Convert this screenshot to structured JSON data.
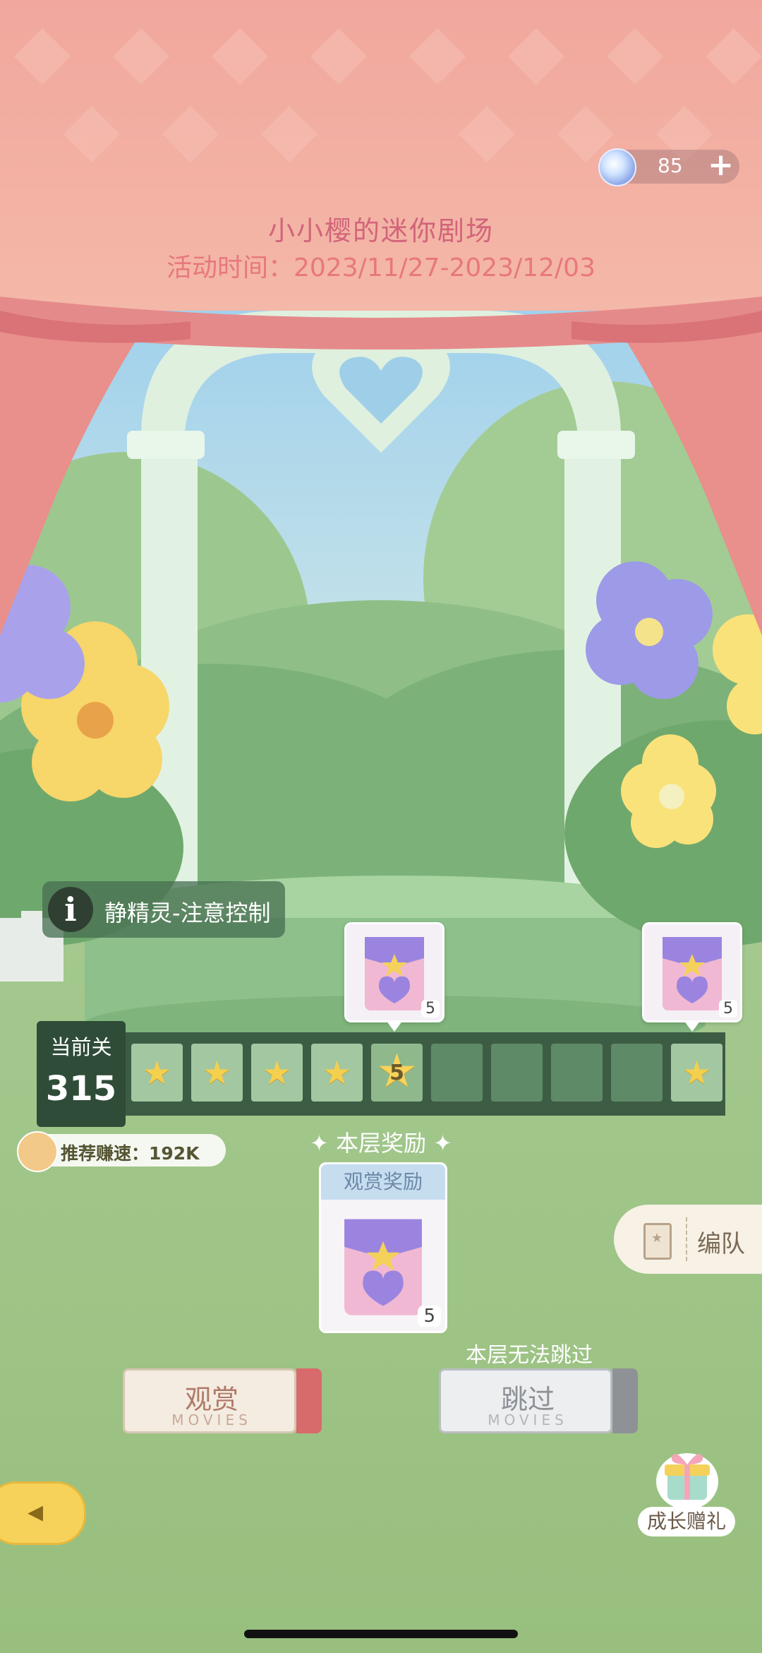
{
  "currency": {
    "value": "85",
    "plus": "+",
    "icon": "crystal-gem-icon"
  },
  "event": {
    "title": "小小樱的迷你剧场",
    "time": "活动时间：2023/11/27-2023/12/03"
  },
  "hint": {
    "icon": "info-icon",
    "label": "静精灵-注意控制"
  },
  "level": {
    "label": "当前关",
    "number": "315"
  },
  "track": {
    "current_label": "5",
    "cells": [
      "star",
      "star",
      "star",
      "star",
      "current",
      "empty",
      "empty",
      "empty",
      "empty",
      "star"
    ]
  },
  "milestone_rewards": [
    {
      "count": "5",
      "icon": "gift-bag-icon"
    },
    {
      "count": "5",
      "icon": "gift-bag-icon"
    }
  ],
  "recommend": {
    "label": "推荐赚速：192K"
  },
  "floor_reward": {
    "title": "✦ 本层奖励 ✦",
    "card_header": "观赏奖励",
    "count": "5",
    "icon": "gift-bag-icon"
  },
  "team_button": {
    "label": "编队",
    "icon": "card-icon"
  },
  "buttons": {
    "watch": {
      "label": "观赏",
      "sub": "MOVIES"
    },
    "skip": {
      "label": "跳过",
      "sub": "MOVIES"
    },
    "skip_note": "本层无法跳过"
  },
  "growth_gift": {
    "label": "成长赠礼",
    "icon": "gift-box-icon"
  },
  "back_button": {
    "icon": "back-arrow-icon"
  },
  "colors": {
    "curtain": "#f0a49a",
    "title_text": "#d2647a",
    "track_bg": "#3c5c44",
    "star": "#f5cf4e",
    "ground": "#a4c58a",
    "sky": "#bfe0f2"
  }
}
